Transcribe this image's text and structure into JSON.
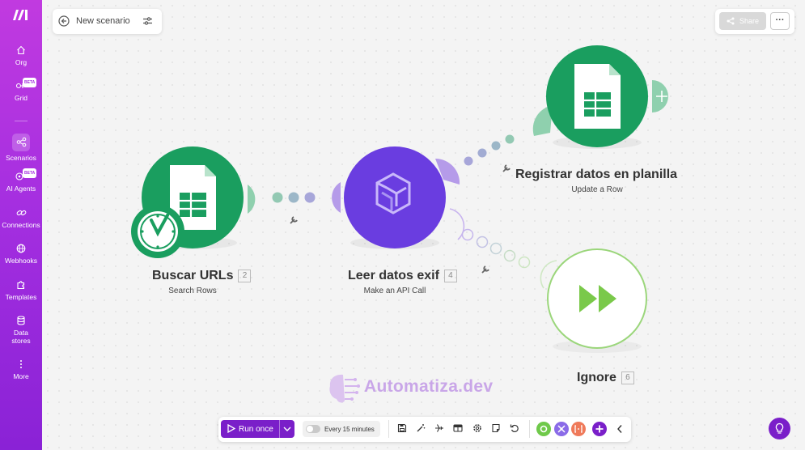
{
  "sidebar": {
    "items": [
      {
        "label": "Org",
        "icon": "home-icon"
      },
      {
        "label": "Grid",
        "icon": "grid-icon",
        "badge": "BETA"
      },
      {
        "label": "Scenarios",
        "icon": "scenarios-icon",
        "active": true
      },
      {
        "label": "AI Agents",
        "icon": "ai-agents-icon",
        "badge": "BETA"
      },
      {
        "label": "Connections",
        "icon": "link-icon"
      },
      {
        "label": "Webhooks",
        "icon": "globe-icon"
      },
      {
        "label": "Templates",
        "icon": "puzzle-icon"
      },
      {
        "label": "Data stores",
        "icon": "database-icon"
      },
      {
        "label": "More",
        "icon": "more-vertical-icon"
      }
    ]
  },
  "header": {
    "scenario_name": "New scenario",
    "share_label": "Share",
    "more_label": "···"
  },
  "modules": [
    {
      "id": "buscar",
      "title": "Buscar URLs",
      "number": "2",
      "subtitle": "Search Rows",
      "app": "Google Sheets",
      "color": "#1a9e5f"
    },
    {
      "id": "leer",
      "title": "Leer datos exif",
      "number": "4",
      "subtitle": "Make an API Call",
      "app": "HTTP",
      "color": "#6a3de0"
    },
    {
      "id": "registrar",
      "title": "Registrar datos en planilla",
      "number": "",
      "subtitle": "Update a Row",
      "app": "Google Sheets",
      "color": "#1a9e5f"
    },
    {
      "id": "ignore",
      "title": "Ignore",
      "number": "6",
      "subtitle": "",
      "app": "Ignore",
      "color": "#7ac94a"
    }
  ],
  "toolbar": {
    "run_label": "Run once",
    "schedule_label": "Every 15 minutes"
  },
  "watermark": {
    "text": "Automatiza.dev"
  },
  "colors": {
    "brand": "#a52fe0",
    "run": "#7a1fc9",
    "sheets": "#1a9e5f",
    "http": "#6a3de0",
    "ignore": "#7ac94a"
  }
}
